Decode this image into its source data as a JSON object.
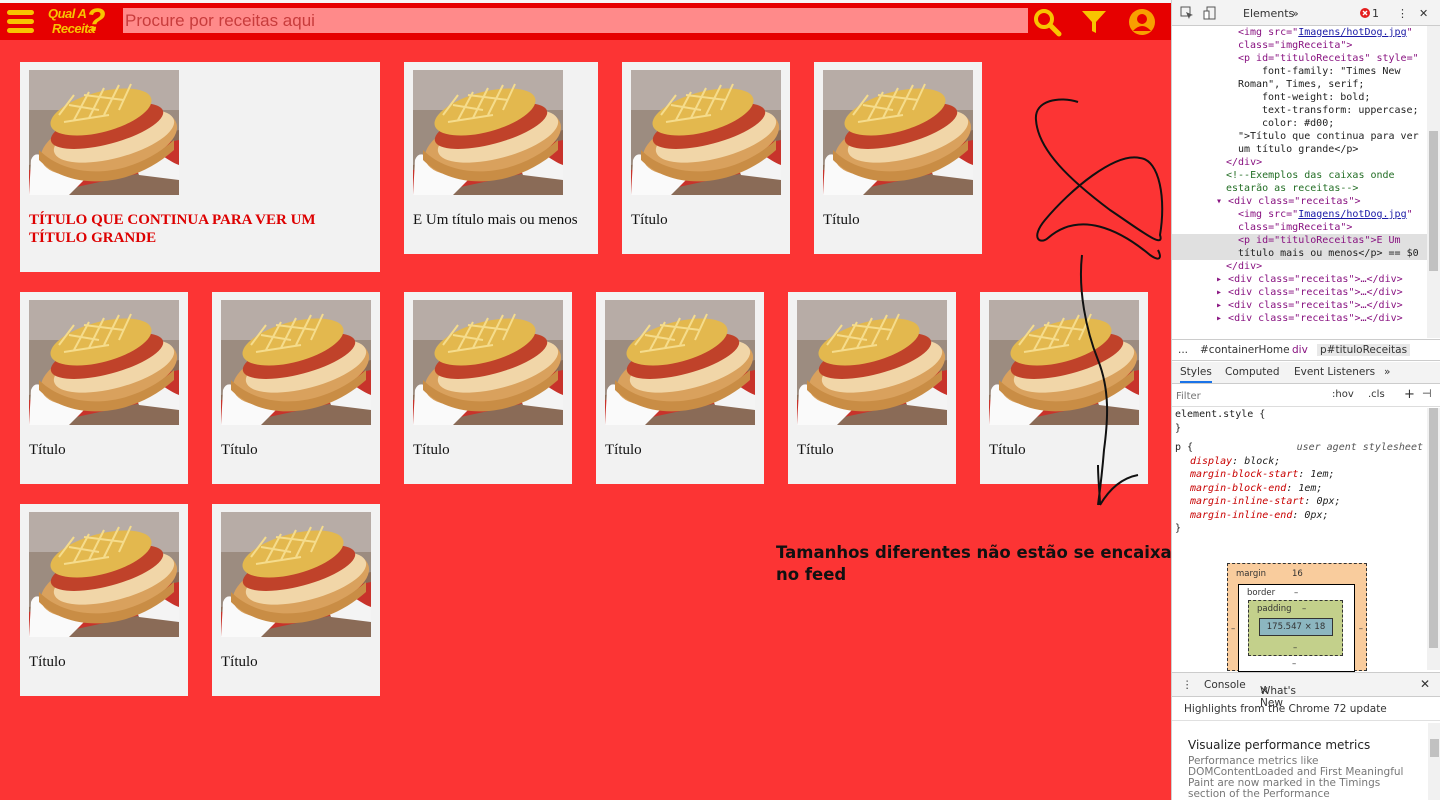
{
  "navbar": {
    "logo_line1": "Qual A",
    "logo_line2": "Receita",
    "logo_mark": "?",
    "search_placeholder": "Procure por receitas aqui",
    "icons": [
      "menu-icon",
      "search-icon",
      "filter-icon",
      "user-icon"
    ]
  },
  "feed": {
    "cards": [
      {
        "title": "Título que continua para ver um título grande",
        "style": "big"
      },
      {
        "title": "E Um título mais ou menos"
      },
      {
        "title": "Título"
      },
      {
        "title": "Título"
      },
      {
        "title": "Título"
      },
      {
        "title": "Título"
      },
      {
        "title": "Título"
      },
      {
        "title": "Título"
      },
      {
        "title": "Título"
      },
      {
        "title": "Título"
      },
      {
        "title": "Título"
      },
      {
        "title": "Título"
      }
    ]
  },
  "annotation": {
    "line1": "Tamanhos diferentes não estão se encaixando",
    "line2": "no feed"
  },
  "devtools": {
    "tab_elements": "Elements",
    "error_count": "1",
    "code": {
      "l1_pre": "<img src=\"",
      "l1_link": "Imagens/hotDog.jpg",
      "l1_post": "\"",
      "l2": "class=\"imgReceita\">",
      "l3": "<p id=\"tituloReceitas\" style=\"",
      "l4": "font-family: \"Times New",
      "l5": "Roman\", Times, serif;",
      "l6": "font-weight: bold;",
      "l7": "text-transform: uppercase;",
      "l8": "color: #d00;",
      "l9": "\">Título que continua para ver",
      "l10": "um título grande</p>",
      "l11": "</div>",
      "l12": "<!--Exemplos das caixas onde",
      "l13": "estarão as receitas-->",
      "l14": "<div class=\"receitas\">",
      "l15_pre": "<img src=\"",
      "l15_link": "Imagens/hotDog.jpg",
      "l15_post": "\"",
      "l16": "class=\"imgReceita\">",
      "l17": "<p id=\"tituloReceitas\">E Um",
      "l18": "título mais ou menos</p> == $0",
      "l19": "</div>",
      "collapsed": "<div class=\"receitas\">…</div>"
    },
    "breadcrumbs": [
      "...",
      "#containerHome",
      "div",
      "p#tituloReceitas"
    ],
    "panel_tabs": [
      "Styles",
      "Computed",
      "Event Listeners"
    ],
    "filter_placeholder": "Filter",
    "filter_hov": ":hov",
    "filter_cls": ".cls",
    "styles": {
      "element_style": "element.style {",
      "close": "}",
      "p_selector": "p {",
      "p_source": "user agent stylesheet",
      "props": [
        {
          "name": "display",
          "value": "block;"
        },
        {
          "name": "margin-block-start",
          "value": "1em;"
        },
        {
          "name": "margin-block-end",
          "value": "1em;"
        },
        {
          "name": "margin-inline-start",
          "value": "0px;"
        },
        {
          "name": "margin-inline-end",
          "value": "0px;"
        }
      ]
    },
    "box_model": {
      "margin_label": "margin",
      "margin_value": "16",
      "border_label": "border",
      "border_value": "–",
      "padding_label": "padding",
      "padding_value": "–",
      "dash": "–",
      "content_size": "175.547 × 18"
    },
    "drawer": {
      "tab_console": "Console",
      "tab_whats_new": "What's New",
      "highlights": "Highlights from the Chrome 72 update",
      "heading": "Visualize performance metrics",
      "body": "Performance metrics like DOMContentLoaded and First Meaningful Paint are now marked in the Timings section of the Performance"
    }
  }
}
